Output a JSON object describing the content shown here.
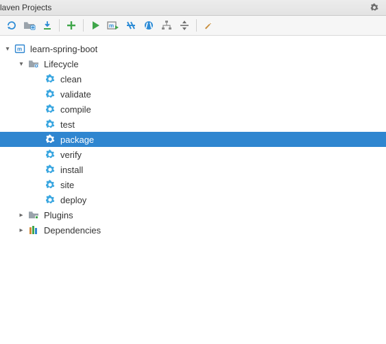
{
  "header": {
    "title": "laven Projects"
  },
  "toolbar": {
    "refresh": "refresh",
    "generate": "generate",
    "download": "download",
    "add": "add",
    "run": "run",
    "debug": "debug",
    "skip_tests": "skip-tests",
    "toggle_offline": "offline",
    "show_deps": "dependencies",
    "collapse": "collapse",
    "settings": "settings"
  },
  "tree": {
    "project": {
      "label": "learn-spring-boot",
      "expanded": true
    },
    "lifecycle": {
      "label": "Lifecycle",
      "expanded": true,
      "goals": [
        {
          "label": "clean",
          "selected": false
        },
        {
          "label": "validate",
          "selected": false
        },
        {
          "label": "compile",
          "selected": false
        },
        {
          "label": "test",
          "selected": false
        },
        {
          "label": "package",
          "selected": true
        },
        {
          "label": "verify",
          "selected": false
        },
        {
          "label": "install",
          "selected": false
        },
        {
          "label": "site",
          "selected": false
        },
        {
          "label": "deploy",
          "selected": false
        }
      ]
    },
    "plugins": {
      "label": "Plugins",
      "expanded": false
    },
    "dependencies": {
      "label": "Dependencies",
      "expanded": false
    }
  }
}
